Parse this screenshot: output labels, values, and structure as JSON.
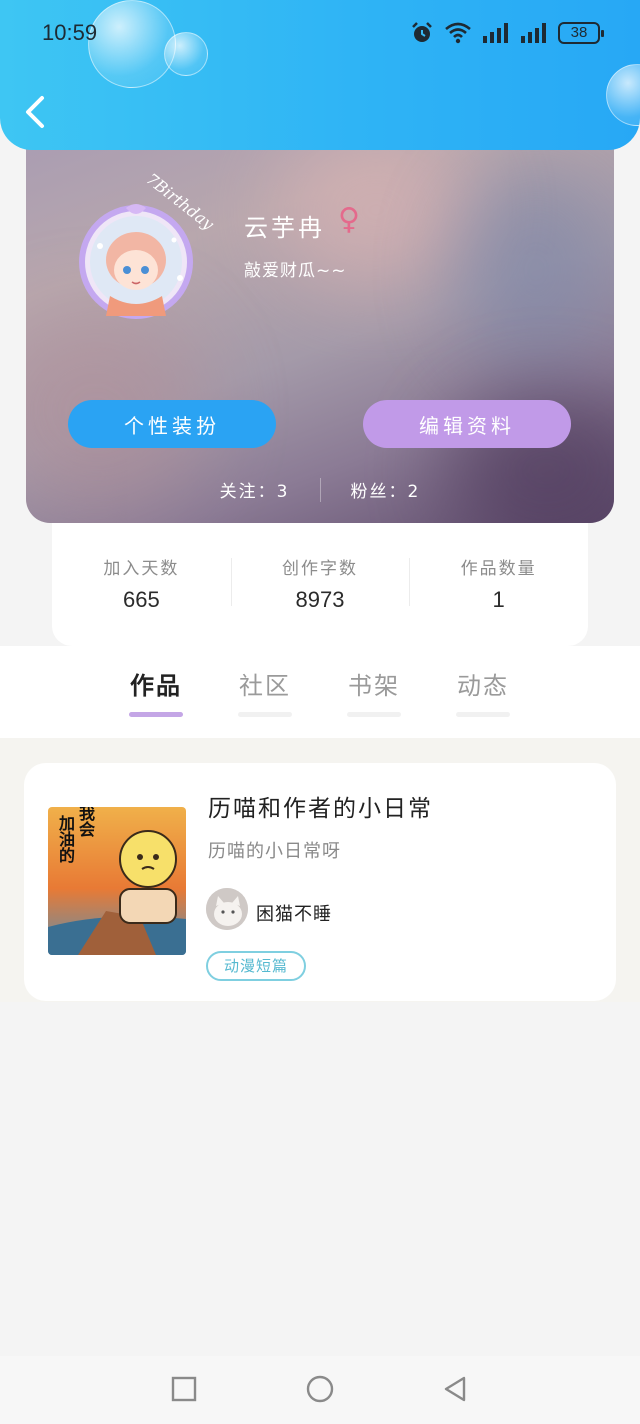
{
  "status_bar": {
    "time": "10:59",
    "battery": "38",
    "icons": [
      "alarm-icon",
      "wifi-icon",
      "signal-icon",
      "signal-icon",
      "battery-icon"
    ]
  },
  "header": {
    "back_icon": "chevron-left-icon"
  },
  "profile": {
    "name": "云芋冉",
    "gender_symbol": "♀",
    "signature": "敲爱财瓜~~",
    "avatar_badge_text": "7Birthday",
    "buttons": {
      "dress_up": "个性装扮",
      "edit_profile": "编辑资料"
    },
    "follow": {
      "label": "关注：",
      "value": "3"
    },
    "fans": {
      "label": "粉丝：",
      "value": "2"
    }
  },
  "stats": [
    {
      "label": "加入天数",
      "value": "665"
    },
    {
      "label": "创作字数",
      "value": "8973"
    },
    {
      "label": "作品数量",
      "value": "1"
    }
  ],
  "tabs": [
    {
      "label": "作品",
      "active": true
    },
    {
      "label": "社区",
      "active": false
    },
    {
      "label": "书架",
      "active": false
    },
    {
      "label": "动态",
      "active": false
    }
  ],
  "works": [
    {
      "title": "历喵和作者的小日常",
      "description": "历喵的小日常呀",
      "cover_text": [
        "我会",
        "加油的"
      ],
      "author": "困猫不睡",
      "tag": "动漫短篇"
    }
  ],
  "nav_bar": {
    "icons": [
      "square-icon",
      "circle-icon",
      "triangle-back-icon"
    ]
  },
  "colors": {
    "header_blue": "#2fb4f5",
    "dress_button": "#2aa3f3",
    "edit_button": "#c19ae8",
    "active_tab_line": "#c4a6e6",
    "gender": "#e46a8c",
    "tag": "#56b9d0"
  }
}
